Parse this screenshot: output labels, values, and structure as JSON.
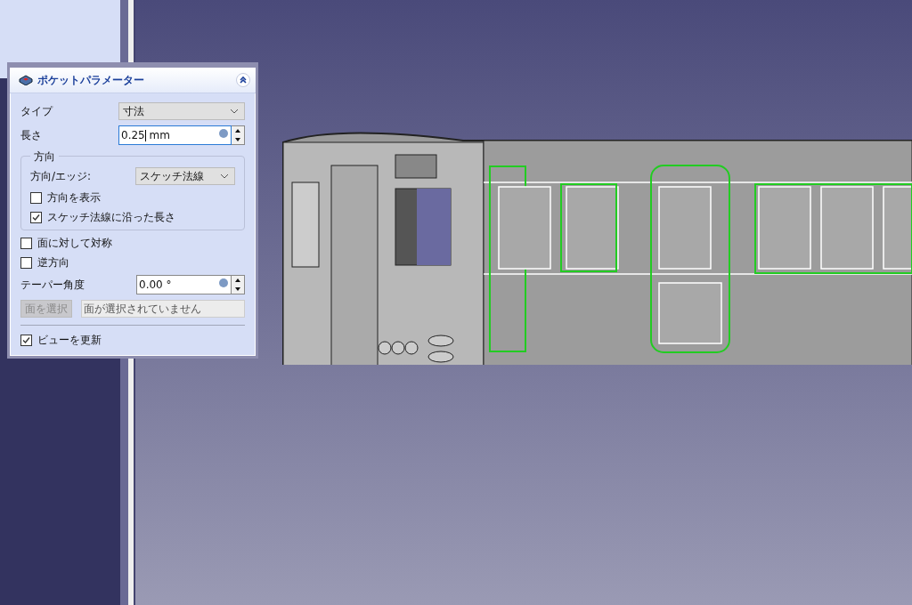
{
  "panel": {
    "title": "ポケットパラメーター",
    "expanded": true
  },
  "type": {
    "label": "タイプ",
    "value": "寸法"
  },
  "length": {
    "label": "長さ",
    "value": "0.25",
    "unit": "mm"
  },
  "direction": {
    "title": "方向",
    "edge_label": "方向/エッジ:",
    "edge_value": "スケッチ法線",
    "options": [
      {
        "label": "方向を表示",
        "checked": false
      },
      {
        "label": "スケッチ法線に沿った長さ",
        "checked": true
      }
    ]
  },
  "options": [
    {
      "label": "面に対して対称",
      "checked": false
    },
    {
      "label": "逆方向",
      "checked": false
    }
  ],
  "taper": {
    "label": "テーパー角度",
    "value": "0.00 °"
  },
  "face": {
    "button": "面を選択",
    "disabled": true,
    "placeholder": "面が選択されていません"
  },
  "update_view": {
    "label": "ビューを更新",
    "checked": true
  }
}
